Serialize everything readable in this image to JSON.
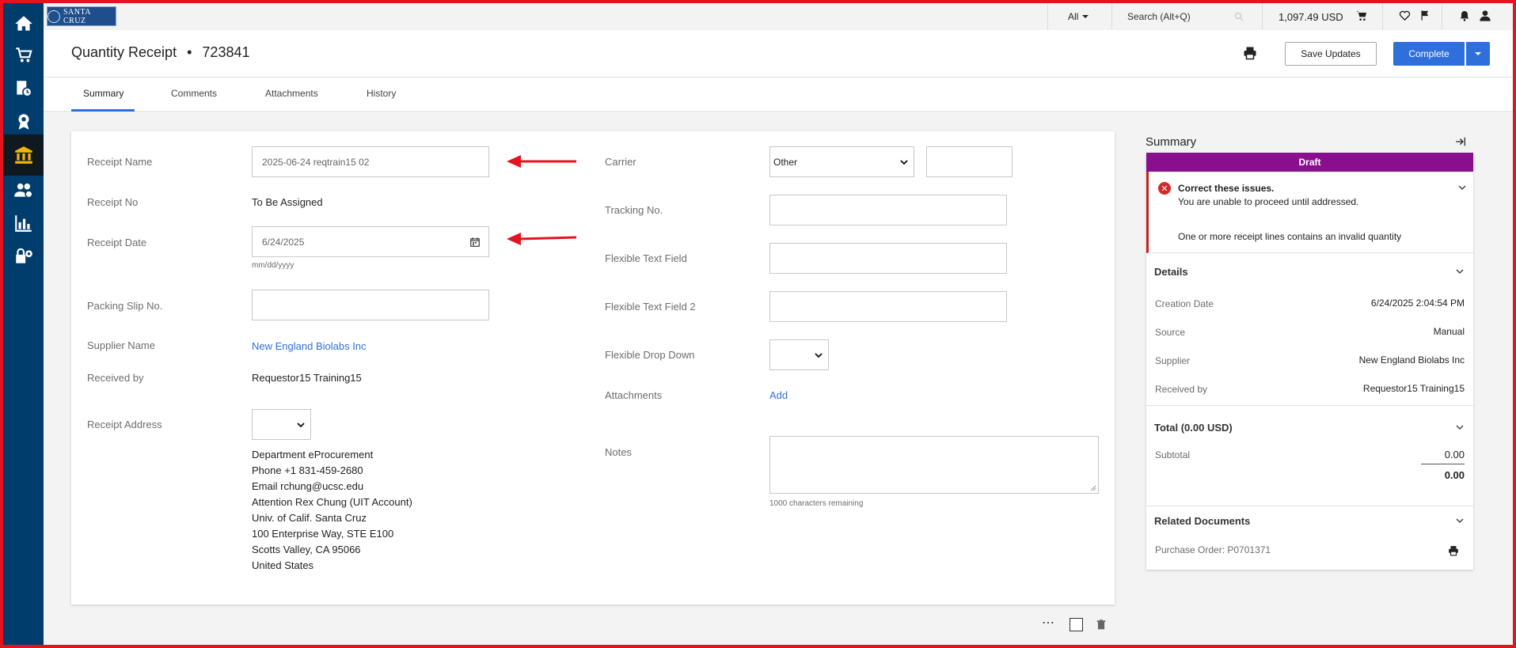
{
  "topbar": {
    "logo_text": "SANTA CRUZ",
    "search_scope": "All",
    "search_placeholder": "Search (Alt+Q)",
    "cart_total": "1,097.49 USD"
  },
  "header": {
    "title": "Quantity Receipt",
    "separator": "•",
    "number": "723841",
    "save_label": "Save Updates",
    "complete_label": "Complete"
  },
  "tabs": [
    "Summary",
    "Comments",
    "Attachments",
    "History"
  ],
  "form": {
    "receipt_name_label": "Receipt Name",
    "receipt_name_value": "2025-06-24 reqtrain15 02",
    "receipt_no_label": "Receipt No",
    "receipt_no_value": "To Be Assigned",
    "receipt_date_label": "Receipt Date",
    "receipt_date_value": "6/24/2025",
    "date_hint": "mm/dd/yyyy",
    "packing_slip_label": "Packing Slip No.",
    "supplier_name_label": "Supplier Name",
    "supplier_name_value": "New England Biolabs Inc",
    "received_by_label": "Received by",
    "received_by_value": "Requestor15 Training15",
    "receipt_address_label": "Receipt Address",
    "address_lines": [
      "Department eProcurement",
      "Phone +1 831-459-2680",
      "Email rchung@ucsc.edu",
      "Attention Rex Chung (UIT Account)",
      "Univ. of Calif. Santa Cruz",
      "100 Enterprise Way, STE E100",
      "Scotts Valley, CA 95066",
      "United States"
    ],
    "carrier_label": "Carrier",
    "carrier_value": "Other",
    "tracking_label": "Tracking No.",
    "flex_text_label": "Flexible Text Field",
    "flex_text2_label": "Flexible Text Field 2",
    "flex_drop_label": "Flexible Drop Down",
    "attachments_label": "Attachments",
    "attachments_add": "Add",
    "notes_label": "Notes",
    "notes_hint": "1000 characters remaining"
  },
  "summary": {
    "title": "Summary",
    "status": "Draft",
    "error_title": "Correct these issues.",
    "error_sub": "You are unable to proceed until addressed.",
    "error_detail": "One or more receipt lines contains an invalid quantity",
    "details_head": "Details",
    "creation_date_label": "Creation Date",
    "creation_date_value": "6/24/2025 2:04:54 PM",
    "source_label": "Source",
    "source_value": "Manual",
    "supplier_label": "Supplier",
    "supplier_value": "New England Biolabs Inc",
    "received_by_label": "Received by",
    "received_by_value": "Requestor15 Training15",
    "total_head": "Total (0.00 USD)",
    "subtotal_label": "Subtotal",
    "subtotal_value": "0.00",
    "total_value": "0.00",
    "related_head": "Related Documents",
    "po_link": "Purchase Order: P0701371"
  },
  "footer": {
    "more_icon": "⋯"
  },
  "colors": {
    "nav_bg": "#003c6c",
    "accent": "#2f6fdc",
    "draft": "#8a0f8e",
    "error": "#d42a2a",
    "arrow": "#e3141f"
  }
}
